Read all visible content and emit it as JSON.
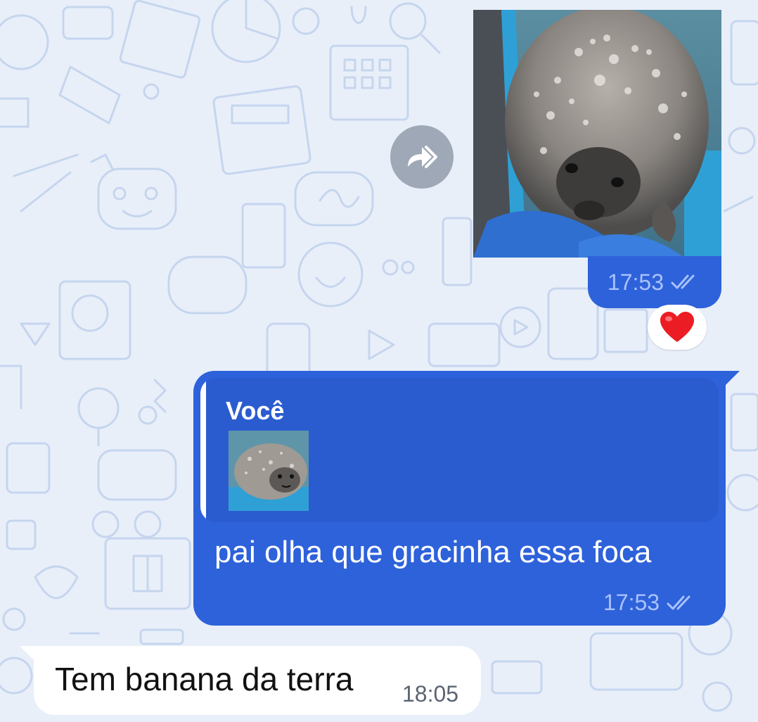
{
  "messages": {
    "photo": {
      "time": "17:53",
      "status_icon": "double-check-icon",
      "reaction": "❤️"
    },
    "reply": {
      "quoted_author": "Você",
      "text": "pai olha que gracinha essa foca",
      "time": "17:53",
      "status_icon": "double-check-icon"
    },
    "incoming": {
      "text": "Tem banana da terra",
      "time": "18:05"
    }
  },
  "forward_icon": "share-forward-icon",
  "colors": {
    "background": "#e8eff9",
    "outgoing_bubble": "#2e62da",
    "incoming_bubble": "#ffffff",
    "meta_text": "#a9c2ff"
  }
}
